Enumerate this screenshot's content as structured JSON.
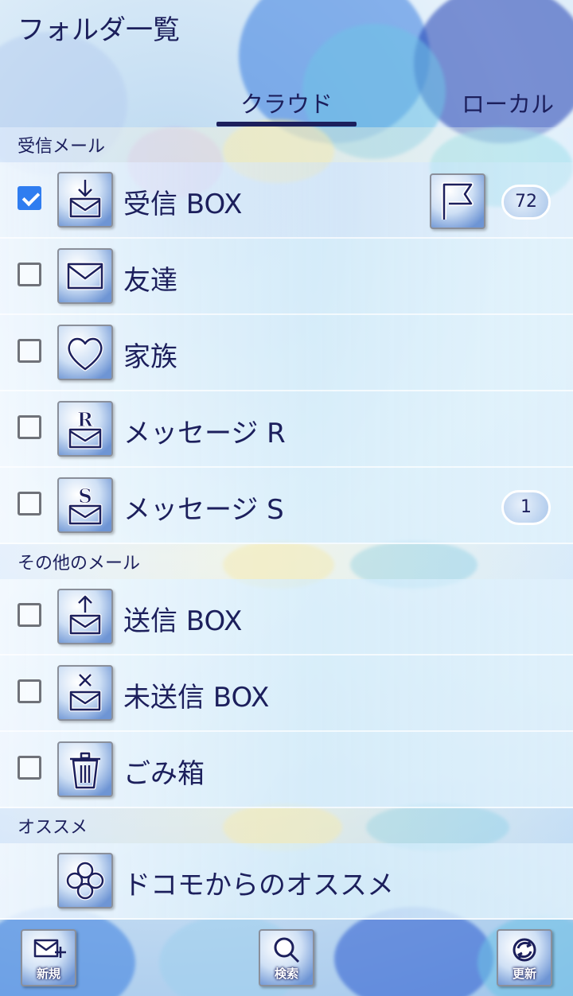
{
  "header": {
    "title": "フォルダ一覧",
    "tabs": [
      {
        "label": "クラウド",
        "active": true
      },
      {
        "label": "ローカル",
        "active": false
      }
    ]
  },
  "sections": {
    "inbox": "受信メール",
    "other": "その他のメール",
    "recommend": "オススメ"
  },
  "folders": [
    {
      "label": "受信 BOX",
      "icon": "inbox-download-icon",
      "checked": true,
      "badge": "72"
    },
    {
      "label": "友達",
      "icon": "envelope-icon",
      "checked": false,
      "badge": ""
    },
    {
      "label": "家族",
      "icon": "heart-icon",
      "checked": false,
      "badge": ""
    },
    {
      "label": "メッセージ R",
      "icon": "message-r-icon",
      "checked": false,
      "badge": ""
    },
    {
      "label": "メッセージ S",
      "icon": "message-s-icon",
      "checked": false,
      "badge": "1"
    },
    {
      "label": "送信 BOX",
      "icon": "outbox-upload-icon",
      "checked": false,
      "badge": ""
    },
    {
      "label": "未送信 BOX",
      "icon": "unsent-x-icon",
      "checked": false,
      "badge": ""
    },
    {
      "label": "ごみ箱",
      "icon": "trash-icon",
      "checked": false,
      "badge": ""
    },
    {
      "label": "ドコモからのオススメ",
      "icon": "clover-icon",
      "checked": false,
      "badge": ""
    }
  ],
  "bottom_bar": {
    "new_label": "新規",
    "search_label": "検索",
    "refresh_label": "更新"
  },
  "colors": {
    "text": "#1c1f5c",
    "checkbox_on": "#2f7df0"
  }
}
